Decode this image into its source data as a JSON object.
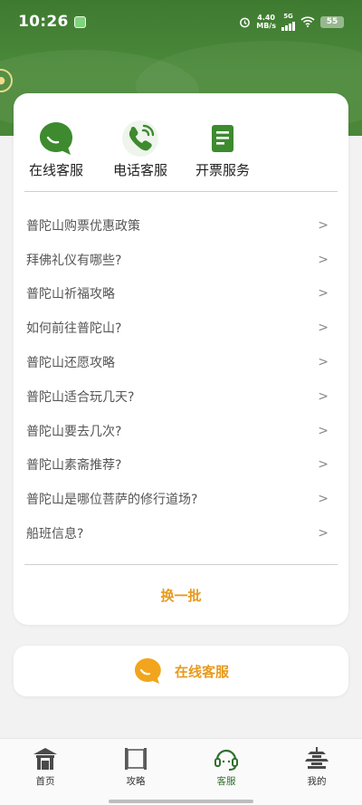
{
  "status_bar": {
    "time": "10:26",
    "net_speed_value": "4.40",
    "net_speed_unit": "MB/s",
    "network": "5G",
    "battery": "55"
  },
  "quick_actions": [
    {
      "label": "在线客服",
      "icon": "chat-bubble-icon"
    },
    {
      "label": "电话客服",
      "icon": "phone-icon"
    },
    {
      "label": "开票服务",
      "icon": "document-icon"
    }
  ],
  "faq": [
    {
      "question": "普陀山购票优惠政策",
      "arrow": ">"
    },
    {
      "question": "拜佛礼仪有哪些?",
      "arrow": ">"
    },
    {
      "question": "普陀山祈福攻略",
      "arrow": ">"
    },
    {
      "question": "如何前往普陀山?",
      "arrow": ">"
    },
    {
      "question": "普陀山还愿攻略",
      "arrow": ">"
    },
    {
      "question": "普陀山适合玩几天?",
      "arrow": ">"
    },
    {
      "question": "普陀山要去几次?",
      "arrow": ">"
    },
    {
      "question": "普陀山素斋推荐?",
      "arrow": ">"
    },
    {
      "question": "普陀山是哪位菩萨的修行道场?",
      "arrow": ">"
    },
    {
      "question": "船班信息?",
      "arrow": ">"
    }
  ],
  "swap_label": "换一批",
  "online_service_label": "在线客服",
  "tabs": [
    {
      "label": "首页",
      "icon": "temple-icon"
    },
    {
      "label": "攻略",
      "icon": "scroll-icon"
    },
    {
      "label": "客服",
      "icon": "headset-icon",
      "active": true
    },
    {
      "label": "我的",
      "icon": "pagoda-icon"
    }
  ],
  "colors": {
    "brand_green": "#4b8a3a",
    "accent_orange": "#e89a1c",
    "active_tab": "#2f6f2f"
  }
}
